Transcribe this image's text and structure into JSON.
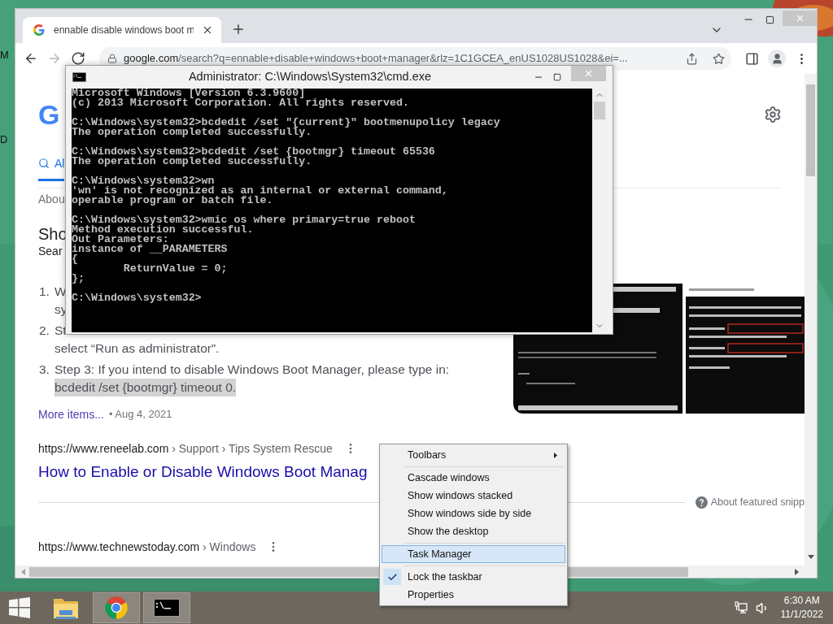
{
  "desktop": {
    "icon_labels": [
      "M",
      "D"
    ]
  },
  "browser": {
    "tab": {
      "title": "ennable disable windows boot m"
    },
    "nav": [
      {
        "kind": "back",
        "disabled": false
      },
      {
        "kind": "forward",
        "disabled": true
      },
      {
        "kind": "reload",
        "disabled": false
      }
    ],
    "url": {
      "host": "google.com",
      "path": "/search?q=ennable+disable+windows+boot+manager&rlz=1C1GCEA_enUS1028US1028&ei=..."
    },
    "page": {
      "logo": "G",
      "search_tab": {
        "label": "Al",
        "selected": true
      },
      "result_stats": "Abou",
      "snippet_heading": "Sho",
      "snippet_source": "Sear",
      "steps": [
        {
          "number": "1.",
          "lines": [
            {
              "text": "W",
              "highlighted": false
            },
            {
              "text": "sy",
              "highlighted": false
            }
          ]
        },
        {
          "number": "2.",
          "lines": [
            {
              "text": "St",
              "highlighted": false
            },
            {
              "text": "select “Run as administrator”.",
              "highlighted": false
            }
          ]
        },
        {
          "number": "3.",
          "lines": [
            {
              "text": "Step 3: If you intend to disable Windows Boot Manager, please type in:",
              "highlighted": false
            },
            {
              "text": "bcdedit /set {bootmgr} timeout 0.",
              "highlighted": true
            }
          ]
        }
      ],
      "more_items": "More items...",
      "date": "• Aug 4, 2021",
      "results": [
        {
          "site": "https://www.reneelab.com",
          "breadcrumb": "› Support › Tips System Rescue",
          "title": "How to Enable or Disable Windows Boot Manag"
        },
        {
          "site": "https://www.technewstoday.com",
          "breadcrumb": "› Windows"
        }
      ],
      "about_snippets": "About featured snipp"
    }
  },
  "console": {
    "title": "Administrator: C:\\Windows\\System32\\cmd.exe",
    "blocks": [
      [
        "Microsoft Windows [Version 6.3.9600]",
        "(c) 2013 Microsoft Corporation. All rights reserved."
      ],
      [
        "C:\\Windows\\system32>bcdedit /set \"{current}\" bootmenupolicy legacy",
        "The operation completed successfully."
      ],
      [
        "C:\\Windows\\system32>bcdedit /set {bootmgr} timeout 65536",
        "The operation completed successfully."
      ],
      [
        "C:\\Windows\\system32>wn",
        "'wn' is not recognized as an internal or external command,",
        "operable program or batch file."
      ],
      [
        "C:\\Windows\\system32>wmic os where primary=true reboot",
        "Method execution successful.",
        "Out Parameters:",
        "instance of __PARAMETERS",
        "{",
        "        ReturnValue = 0;",
        "};"
      ],
      [
        "C:\\Windows\\system32>"
      ]
    ]
  },
  "context_menu": {
    "groups": [
      [
        {
          "label": "Toolbars",
          "kind": "submenu",
          "selected": false,
          "checked": false
        }
      ],
      [
        {
          "label": "Cascade windows",
          "kind": "command",
          "selected": false,
          "checked": false
        },
        {
          "label": "Show windows stacked",
          "kind": "command",
          "selected": false,
          "checked": false
        },
        {
          "label": "Show windows side by side",
          "kind": "command",
          "selected": false,
          "checked": false
        },
        {
          "label": "Show the desktop",
          "kind": "command",
          "selected": false,
          "checked": false
        }
      ],
      [
        {
          "label": "Task Manager",
          "kind": "command",
          "selected": true,
          "checked": false
        }
      ],
      [
        {
          "label": "Lock the taskbar",
          "kind": "command",
          "selected": false,
          "checked": true
        },
        {
          "label": "Properties",
          "kind": "command",
          "selected": false,
          "checked": false
        }
      ]
    ]
  },
  "taskbar": {
    "apps": [
      {
        "kind": "explorer",
        "running": false
      },
      {
        "kind": "chrome",
        "running": true
      },
      {
        "kind": "console",
        "running": true
      }
    ],
    "clock": {
      "time": "6:30 AM",
      "date": "11/1/2022"
    }
  }
}
